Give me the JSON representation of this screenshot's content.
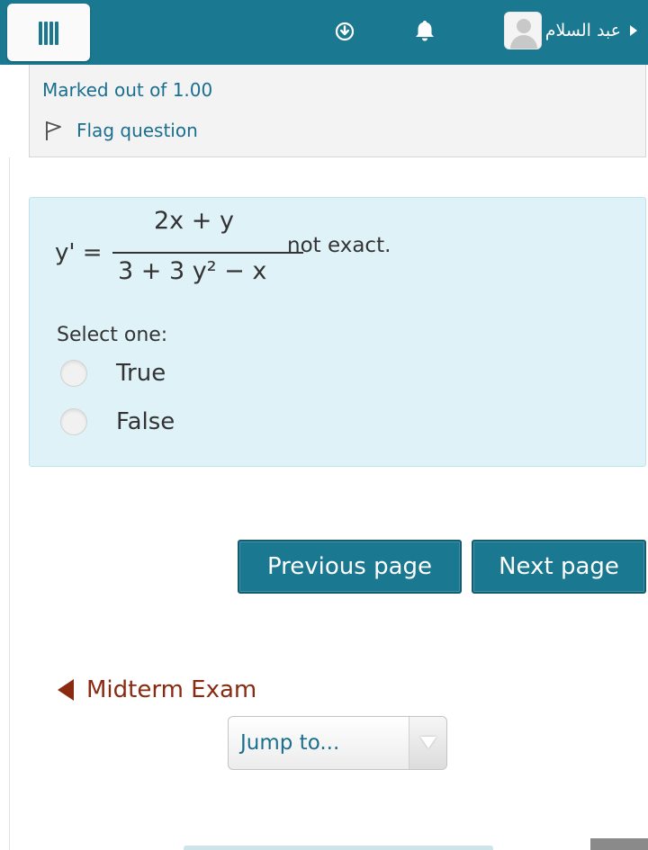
{
  "navbar": {
    "menu_icon": "hamburger-menu-icon",
    "download_icon": "download-circle-icon",
    "bell_icon": "bell-icon",
    "user_name": "عبد السلام",
    "user_avatar_icon": "user-avatar-icon",
    "user_caret_icon": "caret-right-icon",
    "color": "#1a7891"
  },
  "info": {
    "marked": "Marked out of 1.00",
    "flag_label": "Flag question",
    "flag_icon": "flag-icon"
  },
  "question": {
    "lhs": "y' =",
    "numerator": "2x + y",
    "denominator": "3 + 3 y² − x",
    "tail": "not exact.",
    "prompt": "Select one:",
    "options": [
      {
        "label": "True"
      },
      {
        "label": "False"
      }
    ],
    "background": "#def2f8"
  },
  "buttons": {
    "previous": "Previous page",
    "next": "Next page"
  },
  "activity_nav": {
    "previous_label": "Midterm Exam",
    "jump_label": "Jump to...",
    "link_color": "#8a2a10"
  }
}
